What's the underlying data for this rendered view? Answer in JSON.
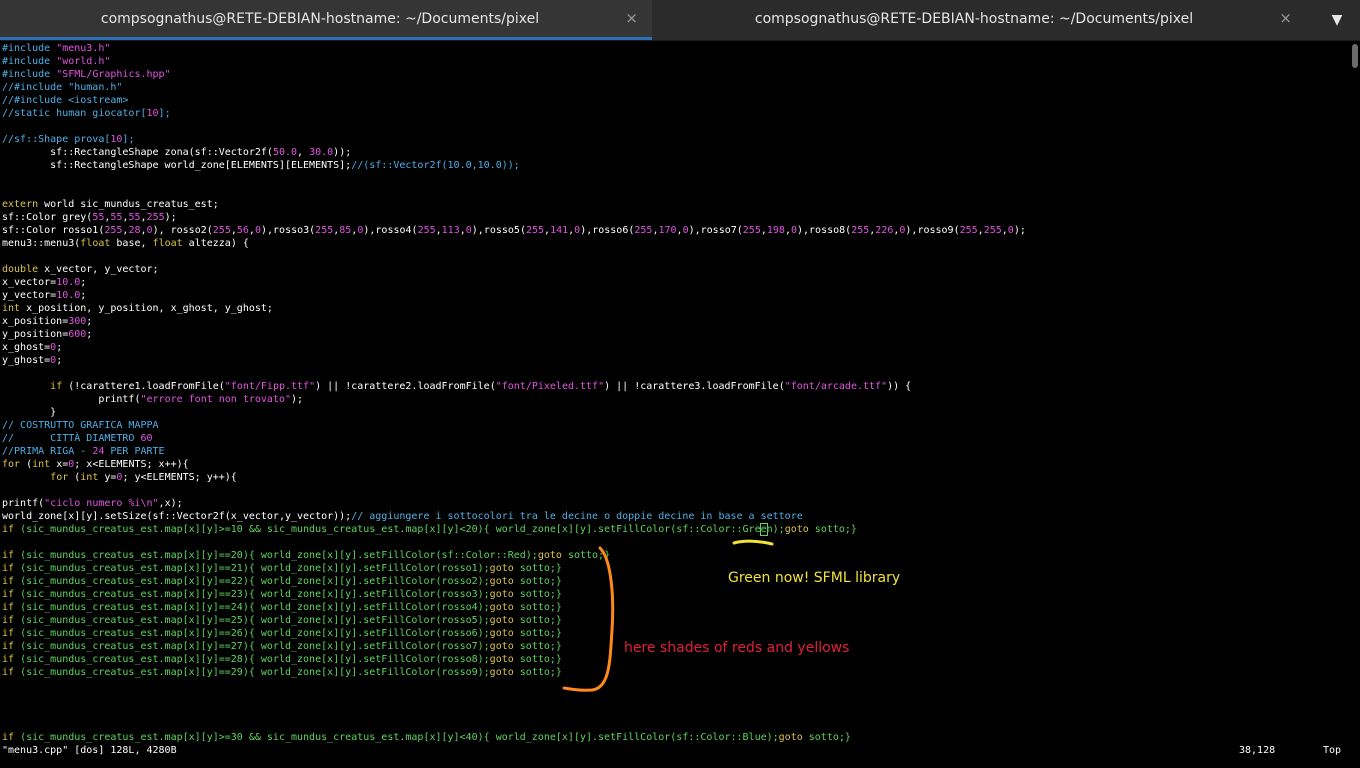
{
  "tabs": [
    {
      "title": "compsognathus@RETE-DEBIAN-hostname: ~/Documents/pixel",
      "close": "×"
    },
    {
      "title": "compsognathus@RETE-DEBIAN-hostname: ~/Documents/pixel",
      "close": "×"
    }
  ],
  "menu_icon": "chevron-down-icon",
  "code_lines": [
    "#include \"menu3.h\"",
    "#include \"world.h\"",
    "#include \"SFML/Graphics.hpp\"",
    "//#include \"human.h\"",
    "//#include <iostream>",
    "//static human giocator[10];",
    "",
    "//sf::Shape prova[10];",
    "        sf::RectangleShape zona(sf::Vector2f(50.0, 30.0));",
    "        sf::RectangleShape world_zone[ELEMENTS][ELEMENTS];//(sf::Vector2f(10.0,10.0));",
    "",
    "",
    "extern world sic_mundus_creatus_est;",
    "sf::Color grey(55,55,55,255);",
    "sf::Color rosso1(255,28,0), rosso2(255,56,0),rosso3(255,85,0),rosso4(255,113,0),rosso5(255,141,0),rosso6(255,170,0),rosso7(255,198,0),rosso8(255,226,0),rosso9(255,255,0);",
    "menu3::menu3(float base, float altezza) {",
    "",
    "double x_vector, y_vector;",
    "x_vector=10.0;",
    "y_vector=10.0;",
    "int x_position, y_position, x_ghost, y_ghost;",
    "x_position=300;",
    "y_position=600;",
    "x_ghost=0;",
    "y_ghost=0;",
    "",
    "        if (!carattere1.loadFromFile(\"font/Fipp.ttf\") || !carattere2.loadFromFile(\"font/Pixeled.ttf\") || !carattere3.loadFromFile(\"font/arcade.ttf\")) {",
    "                printf(\"errore font non trovato\");",
    "        }",
    "// COSTRUTTO GRAFICA MAPPA",
    "//      CITTÀ DIAMETRO 60",
    "//PRIMA RIGA - 24 PER PARTE",
    "for (int x=0; x<ELEMENTS; x++){",
    "        for (int y=0; y<ELEMENTS; y++){",
    "",
    "printf(\"ciclo numero %i\\n\",x);",
    "world_zone[x][y].setSize(sf::Vector2f(x_vector,y_vector));// aggiungere i sottocolori tra le decine o doppie decine in base a settore",
    "if (sic_mundus_creatus_est.map[x][y]>=10 && sic_mundus_creatus_est.map[x][y]<20){ world_zone[x][y].setFillColor(sf::Color::Green);goto sotto;}",
    "",
    "if (sic_mundus_creatus_est.map[x][y]==20){ world_zone[x][y].setFillColor(sf::Color::Red);goto sotto;}",
    "if (sic_mundus_creatus_est.map[x][y]==21){ world_zone[x][y].setFillColor(rosso1);goto sotto;}",
    "if (sic_mundus_creatus_est.map[x][y]==22){ world_zone[x][y].setFillColor(rosso2);goto sotto;}",
    "if (sic_mundus_creatus_est.map[x][y]==23){ world_zone[x][y].setFillColor(rosso3);goto sotto;}",
    "if (sic_mundus_creatus_est.map[x][y]==24){ world_zone[x][y].setFillColor(rosso4);goto sotto;}",
    "if (sic_mundus_creatus_est.map[x][y]==25){ world_zone[x][y].setFillColor(rosso5);goto sotto;}",
    "if (sic_mundus_creatus_est.map[x][y]==26){ world_zone[x][y].setFillColor(rosso6);goto sotto;}",
    "if (sic_mundus_creatus_est.map[x][y]==27){ world_zone[x][y].setFillColor(rosso7);goto sotto;}",
    "if (sic_mundus_creatus_est.map[x][y]==28){ world_zone[x][y].setFillColor(rosso8);goto sotto;}",
    "if (sic_mundus_creatus_est.map[x][y]==29){ world_zone[x][y].setFillColor(rosso9);goto sotto;}",
    "",
    "",
    "",
    "",
    "if (sic_mundus_creatus_est.map[x][y]>=30 && sic_mundus_creatus_est.map[x][y]<40){ world_zone[x][y].setFillColor(sf::Color::Blue);goto sotto;}"
  ],
  "status": {
    "file": "\"menu3.cpp\" [dos] 128L, 4280B",
    "position": "38,128",
    "scroll": "Top"
  },
  "annotations": {
    "green": "Green now! SFML library",
    "red": "here shades of reds and yellows"
  },
  "colors": {
    "comment": "#4fb0e8",
    "string": "#e055e0",
    "keyword": "#d9c54a",
    "annotation_yellow": "#f0e23a",
    "annotation_red": "#e0203a",
    "marker_orange": "#ff8a1a",
    "tab_accent": "#2f6fb7"
  }
}
